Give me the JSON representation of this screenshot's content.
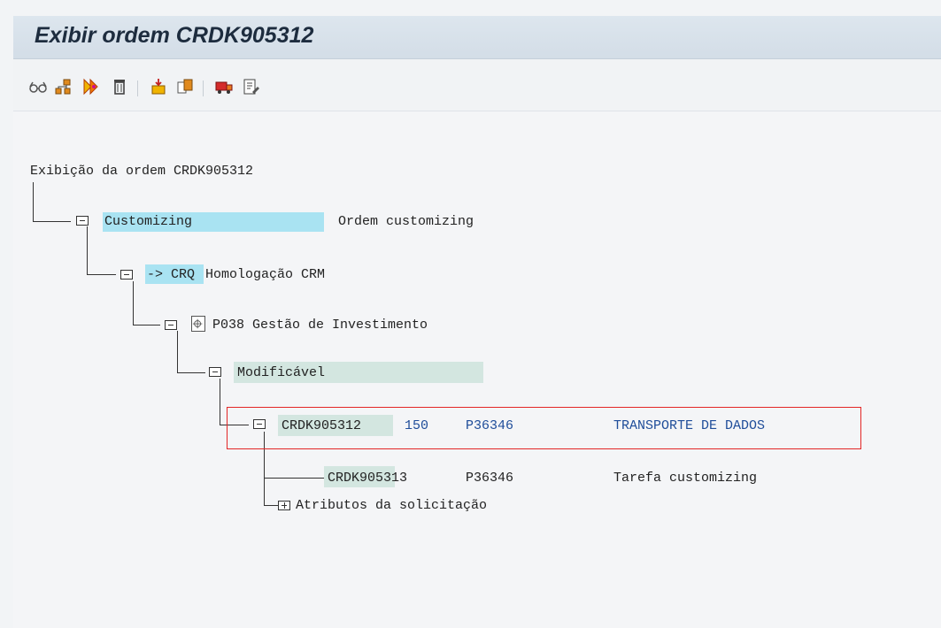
{
  "window": {
    "title": "Exibir ordem CRDK905312"
  },
  "toolbar": {
    "icons": [
      "glasses-icon",
      "hierarchy-icon",
      "execute-icon",
      "delete-icon",
      "import-icon",
      "objects-icon",
      "transport-truck-icon",
      "document-edit-icon"
    ]
  },
  "tree": {
    "root": "Exibição da ordem CRDK905312",
    "customizing": {
      "label": "Customizing",
      "desc": "Ordem customizing"
    },
    "target": {
      "label": "-> CRQ",
      "desc": "Homologação CRM"
    },
    "project": {
      "label": "P038 Gestão de Investimento"
    },
    "status": {
      "label": "Modificável"
    },
    "request": {
      "id": "CRDK905312",
      "client": "150",
      "owner": "P36346",
      "desc": "TRANSPORTE DE DADOS"
    },
    "task": {
      "id": "CRDK905313",
      "owner": "P36346",
      "desc": "Tarefa customizing"
    },
    "attributes": {
      "label": "Atributos da solicitação"
    }
  }
}
